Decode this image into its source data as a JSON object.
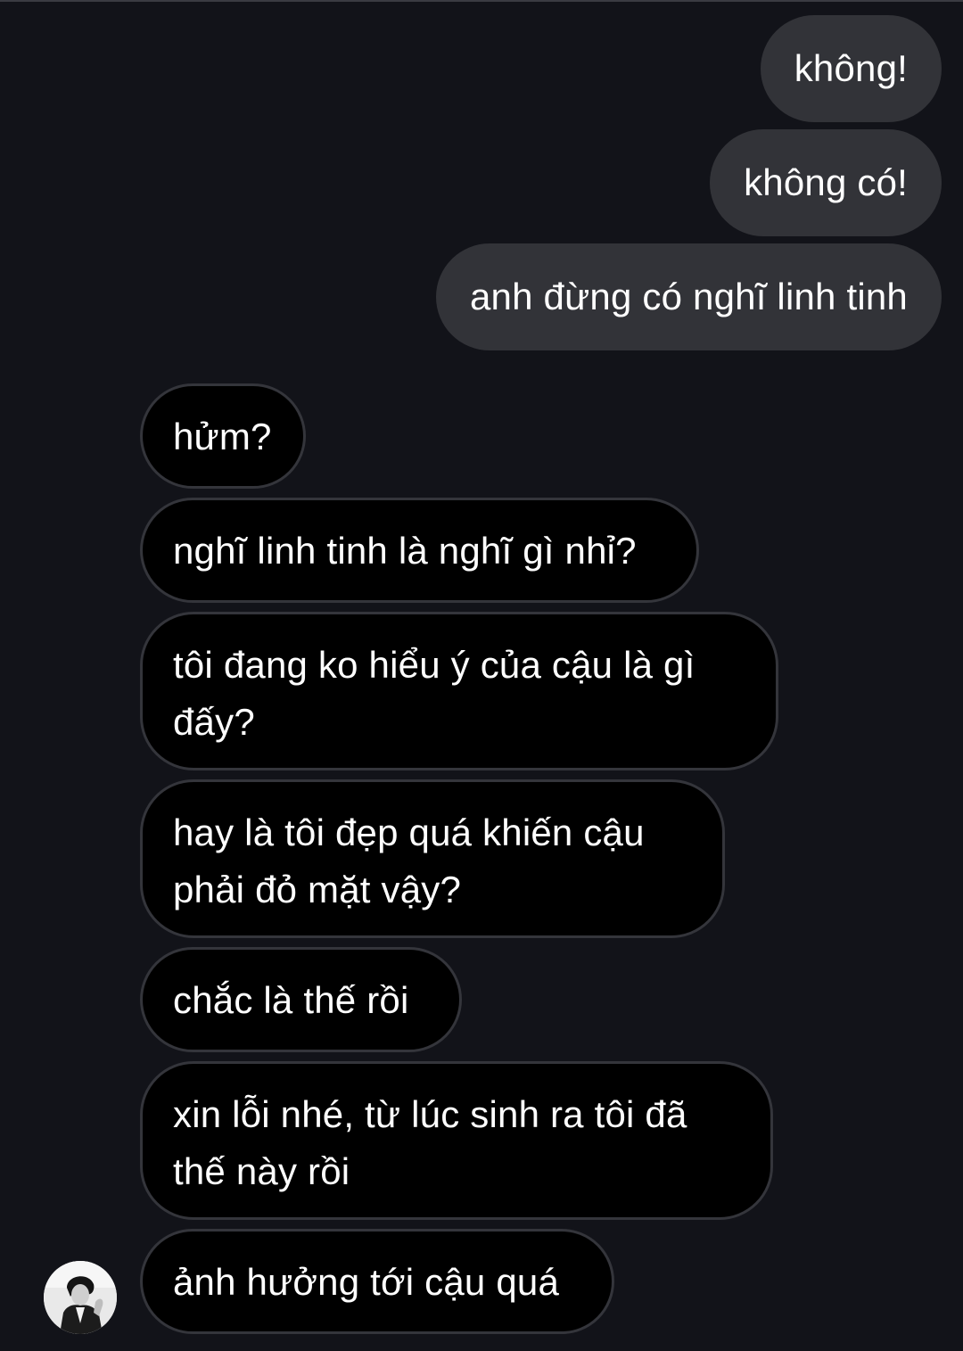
{
  "conversation": {
    "sent": [
      {
        "text": "không!"
      },
      {
        "text": "không có!"
      },
      {
        "text": "anh đừng có nghĩ linh tinh"
      }
    ],
    "received": [
      {
        "text": "hửm?"
      },
      {
        "text": "nghĩ linh tinh là nghĩ gì nhỉ?"
      },
      {
        "text": "tôi đang ko hiểu ý của cậu là gì đấy?"
      },
      {
        "text": "hay là tôi đẹp quá khiến cậu phải đỏ mặt vậy?"
      },
      {
        "text": "chắc là thế rồi"
      },
      {
        "text": "xin lỗi nhé, từ lúc sinh ra tôi đã thế này rồi"
      },
      {
        "text": "ảnh hưởng tới cậu quá"
      }
    ]
  },
  "contact": {
    "avatar_icon": "profile-photo-icon"
  },
  "colors": {
    "background": "#121319",
    "sent_bubble": "#323338",
    "received_bubble": "#000000",
    "received_border": "#34353b",
    "text": "#ffffff"
  }
}
